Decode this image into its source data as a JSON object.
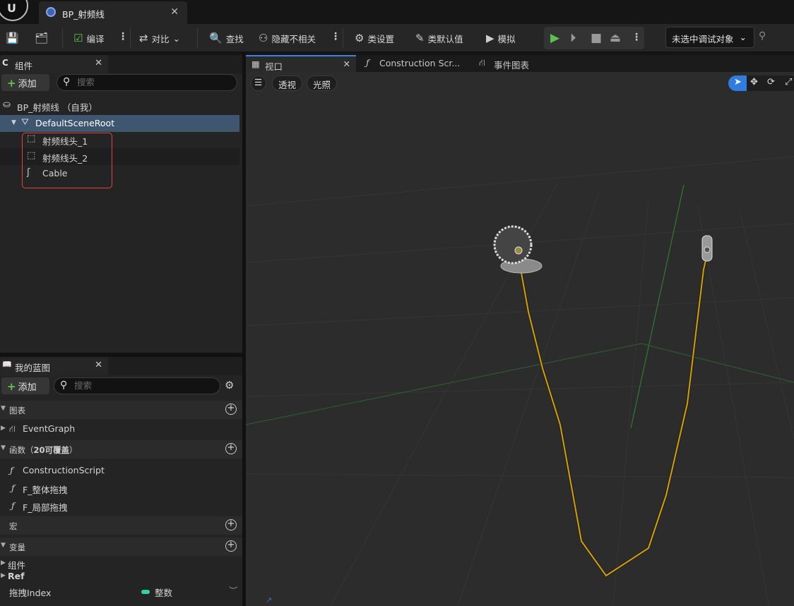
{
  "document_tab": {
    "title": "BP_射频线"
  },
  "toolbar": {
    "compile": "编译",
    "diff": "对比",
    "find": "查找",
    "hide_unrelated": "隐藏不相关",
    "class_settings": "类设置",
    "class_defaults": "类默认值",
    "simulate": "模拟",
    "debug_object": "未选中调试对象"
  },
  "components_panel": {
    "title": "组件",
    "add_label": "添加",
    "search_placeholder": "搜索",
    "root": "BP_射频线 （自我）",
    "scene_root": "DefaultSceneRoot",
    "children": [
      "射频线头_1",
      "射频线头_2",
      "Cable"
    ]
  },
  "my_blueprint_panel": {
    "title": "我的蓝图",
    "add_label": "添加",
    "search_placeholder": "搜索",
    "graphs_header": "图表",
    "event_graph": "EventGraph",
    "functions_header": "函数（",
    "functions_count": "20可覆盖",
    "functions_tail": "）",
    "functions": [
      "ConstructionScript",
      "F_整体拖拽",
      "F_局部拖拽"
    ],
    "macros_header": "宏",
    "variables_header": "变量",
    "variable_groups": [
      "组件",
      "Ref"
    ],
    "variable_name": "拖拽Index",
    "variable_type": "整数",
    "variable_type_color": "#2fd3a6"
  },
  "viewport_tabs": [
    "视口",
    "Construction Scr...",
    "事件图表"
  ],
  "viewport": {
    "perspective": "透视",
    "lighting": "光照",
    "cable_color": "#c9a21a",
    "select_tool_color": "#2f7de0"
  },
  "colors": {
    "accent": "#3b82d8",
    "play": "#5cc24a",
    "highlight": "#e0453a"
  }
}
